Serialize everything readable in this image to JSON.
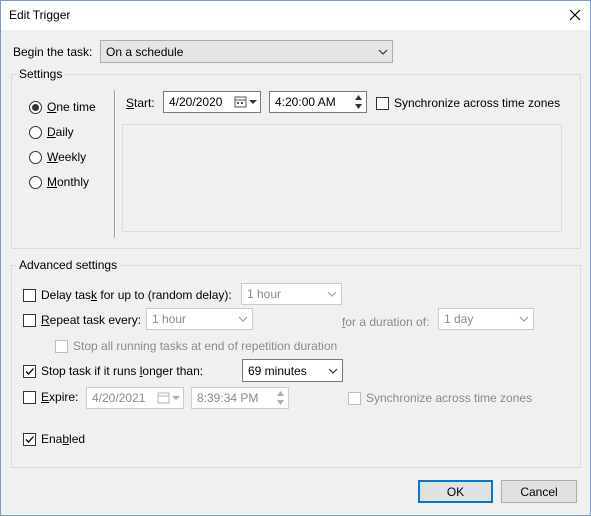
{
  "window": {
    "title": "Edit Trigger"
  },
  "begin": {
    "label_pre": "Begin the task:",
    "value": "On a schedule"
  },
  "settings": {
    "title": "Settings",
    "frequencies": [
      {
        "label": "One time",
        "mnemonic": "O",
        "rest": "ne time",
        "selected": true
      },
      {
        "label": "Daily",
        "mnemonic": "D",
        "rest": "aily",
        "selected": false
      },
      {
        "label": "Weekly",
        "mnemonic": "W",
        "rest": "eekly",
        "selected": false
      },
      {
        "label": "Monthly",
        "mnemonic": "M",
        "rest": "onthly",
        "selected": false
      }
    ],
    "start_label": "Start:",
    "start_date": "4/20/2020",
    "start_time": "4:20:00 AM",
    "sync_label": "Synchronize across time zones",
    "sync_checked": false
  },
  "advanced": {
    "title": "Advanced settings",
    "delay": {
      "label_a": "Delay tas",
      "label_u": "k",
      "label_b": " for up to (random delay):",
      "value": "1 hour",
      "checked": false
    },
    "repeat": {
      "label_a": "R",
      "label_b": "epeat task every:",
      "value": "1 hour",
      "checked": false,
      "duration_label_a": "f",
      "duration_label_b": "or a duration of:",
      "duration_value": "1 day"
    },
    "stop_running": {
      "label": "Stop all running tasks at end of repetition duration",
      "checked": false
    },
    "stop_longer": {
      "label_a": "Stop task if it runs ",
      "label_u": "l",
      "label_b": "onger than:",
      "value": "69 minutes",
      "checked": true
    },
    "expire": {
      "label_a": "E",
      "label_b": "xpire:",
      "date": "4/20/2021",
      "time": "8:39:34 PM",
      "checked": false,
      "sync_label": "Synchronize across time zones"
    },
    "enabled": {
      "label_a": "Ena",
      "label_u": "b",
      "label_b": "led",
      "checked": true
    }
  },
  "buttons": {
    "ok": "OK",
    "cancel": "Cancel"
  }
}
